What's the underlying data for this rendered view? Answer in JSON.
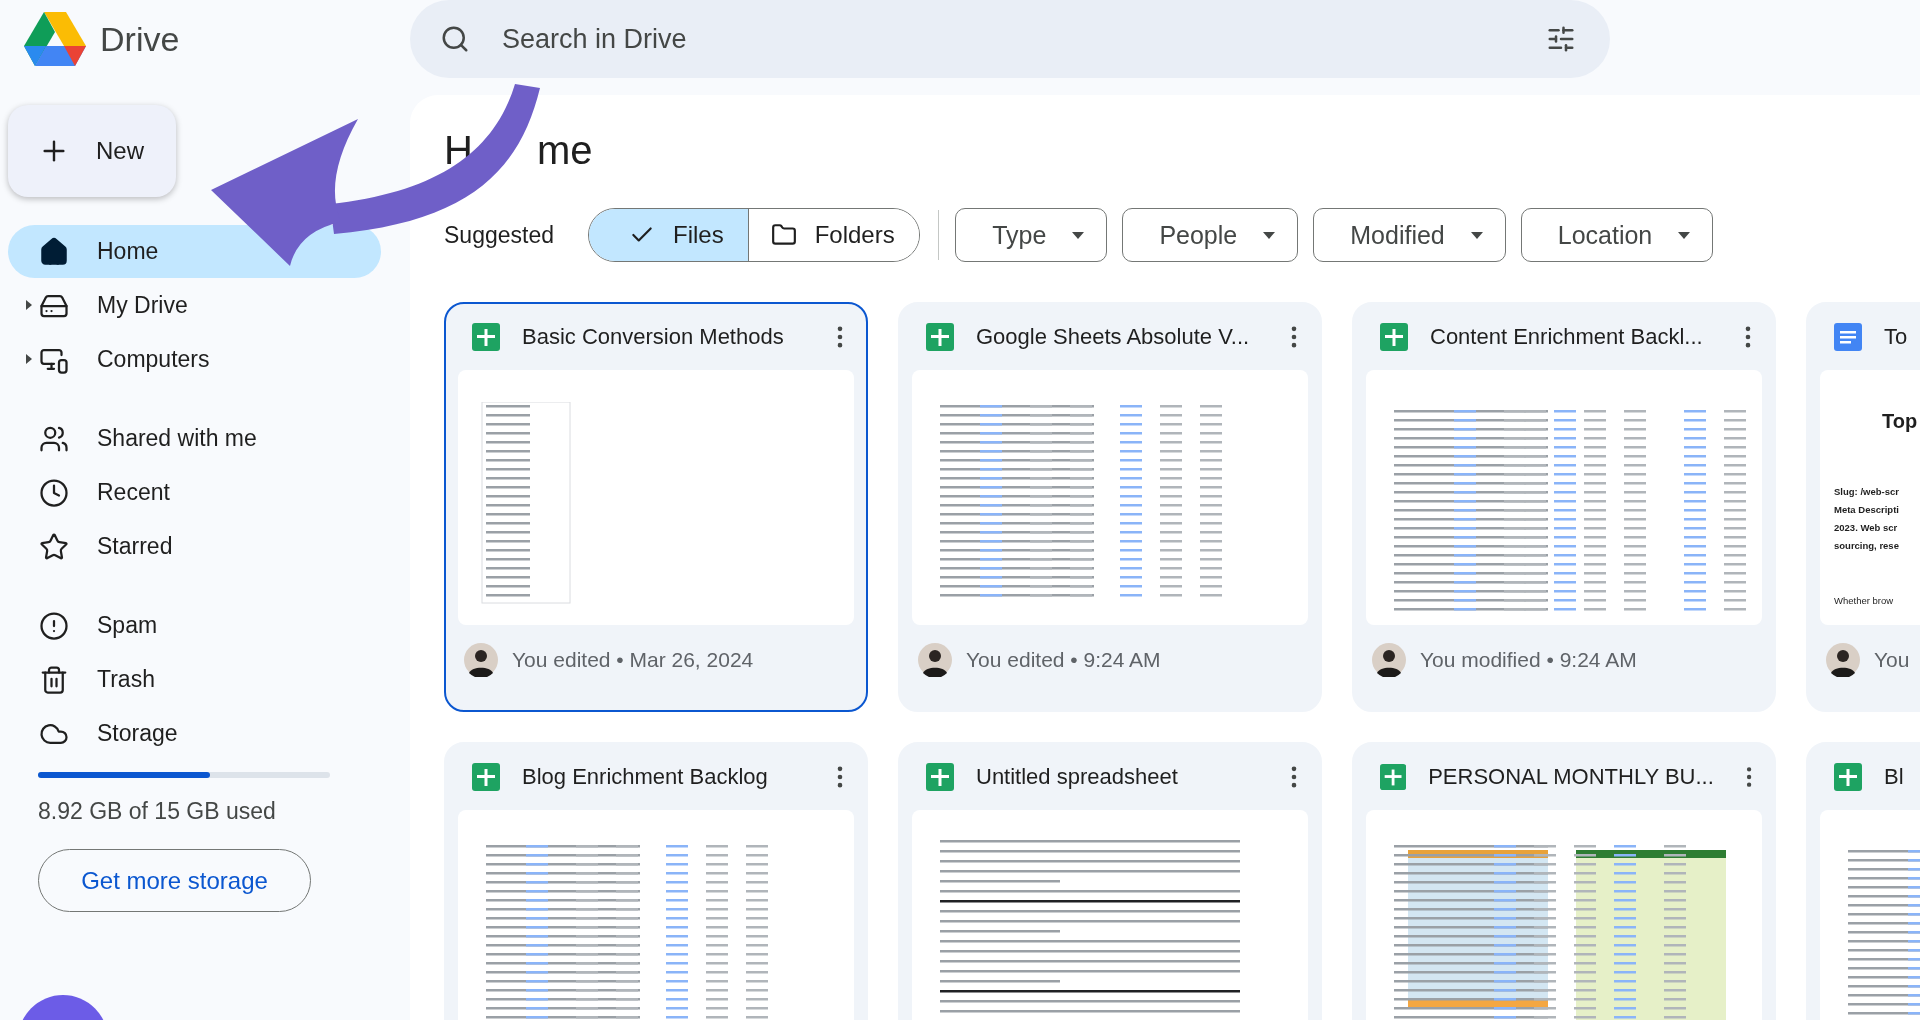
{
  "app": {
    "name": "Drive"
  },
  "search": {
    "placeholder": "Search in Drive"
  },
  "new_button": {
    "label": "New"
  },
  "sidebar": {
    "groups": [
      {
        "items": [
          {
            "kind": "home",
            "label": "Home",
            "selected": true
          },
          {
            "kind": "drive",
            "label": "My Drive",
            "selected": false,
            "expanded": false
          },
          {
            "kind": "computers",
            "label": "Computers",
            "selected": false,
            "expanded": false
          }
        ]
      },
      {
        "items": [
          {
            "kind": "shared",
            "label": "Shared with me",
            "selected": false
          },
          {
            "kind": "recent",
            "label": "Recent",
            "selected": false
          },
          {
            "kind": "starred",
            "label": "Starred",
            "selected": false
          }
        ]
      },
      {
        "items": [
          {
            "kind": "spam",
            "label": "Spam",
            "selected": false
          },
          {
            "kind": "trash",
            "label": "Trash",
            "selected": false
          },
          {
            "kind": "storage",
            "label": "Storage",
            "selected": false
          }
        ]
      }
    ]
  },
  "storage": {
    "level": 0.59,
    "usage": "8.92 GB of 15 GB used",
    "button": "Get more storage"
  },
  "page_title": {
    "parts": [
      "H",
      "me"
    ]
  },
  "filters": {
    "label": "Suggested",
    "toggle": [
      {
        "kind": "files",
        "label": "Files",
        "selected": true
      },
      {
        "kind": "folders",
        "label": "Folders",
        "selected": false
      }
    ],
    "dropdowns": [
      "Type",
      "People",
      "Modified",
      "Location"
    ]
  },
  "files": [
    {
      "kind": "sheet",
      "title": "Basic Conversion Methods",
      "selected": true,
      "preview": {
        "kind": "list"
      },
      "activity": "You edited • Mar 26, 2024"
    },
    {
      "kind": "sheet",
      "title": "Google Sheets Absolute V...",
      "selected": false,
      "preview": {
        "kind": "table"
      },
      "activity": "You edited • 9:24 AM"
    },
    {
      "kind": "sheet",
      "title": "Content Enrichment Backl...",
      "selected": false,
      "preview": {
        "kind": "wide"
      },
      "activity": "You modified • 9:24 AM"
    },
    {
      "kind": "doc",
      "title": "To",
      "selected": false,
      "preview": {
        "kind": "doc",
        "title": "Top",
        "lines": [
          "Slug: /web-scr",
          "Meta Descripti",
          "2023. Web scr",
          "sourcing, rese"
        ],
        "note": "Whether brow"
      },
      "activity": "You"
    },
    {
      "kind": "sheet",
      "title": "Blog Enrichment Backlog",
      "selected": false,
      "preview": {
        "kind": "table"
      }
    },
    {
      "kind": "sheet",
      "title": "Untitled spreadsheet",
      "selected": false,
      "preview": {
        "kind": "text"
      }
    },
    {
      "kind": "sheet",
      "title": "PERSONAL MONTHLY BU...",
      "selected": false,
      "preview": {
        "kind": "budget"
      }
    },
    {
      "kind": "sheet",
      "title": "Bl",
      "selected": false,
      "preview": {
        "kind": "wide"
      }
    }
  ]
}
